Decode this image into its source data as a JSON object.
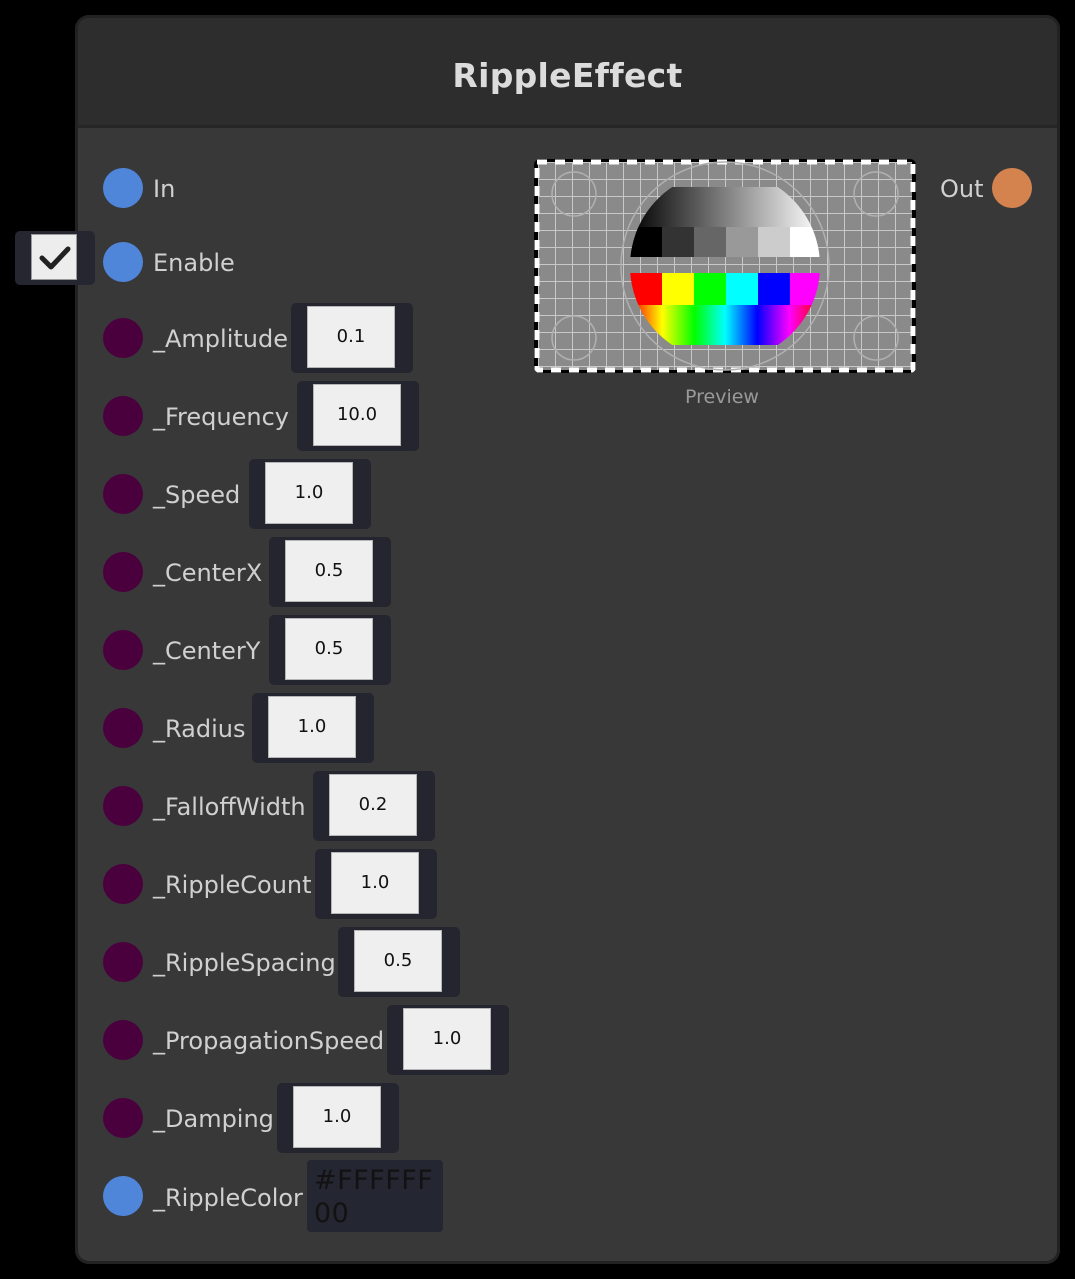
{
  "node": {
    "title": "RippleEffect"
  },
  "ports": {
    "in_label": "In",
    "enable_label": "Enable",
    "out_label": "Out"
  },
  "enable": {
    "checked": true
  },
  "properties": [
    {
      "label": "_Amplitude",
      "value": "0.1"
    },
    {
      "label": "_Frequency",
      "value": "10.0"
    },
    {
      "label": "_Speed",
      "value": "1.0"
    },
    {
      "label": "_CenterX",
      "value": "0.5"
    },
    {
      "label": "_CenterY",
      "value": "0.5"
    },
    {
      "label": "_Radius",
      "value": "1.0"
    },
    {
      "label": "_FalloffWidth",
      "value": "0.2"
    },
    {
      "label": "_RippleCount",
      "value": "1.0"
    },
    {
      "label": "_RippleSpacing",
      "value": "0.5"
    },
    {
      "label": "_PropagationSpeed",
      "value": "1.0"
    },
    {
      "label": "_Damping",
      "value": "1.0"
    }
  ],
  "ripple_color": {
    "label": "_RippleColor",
    "value": "#FFFFFF00"
  },
  "preview": {
    "caption": "Preview"
  },
  "colors": {
    "port_blue": "#4f86d9",
    "port_purple": "#4b003e",
    "port_orange": "#d4834f",
    "node_body": "#383838",
    "node_header": "#2d2d2d"
  }
}
